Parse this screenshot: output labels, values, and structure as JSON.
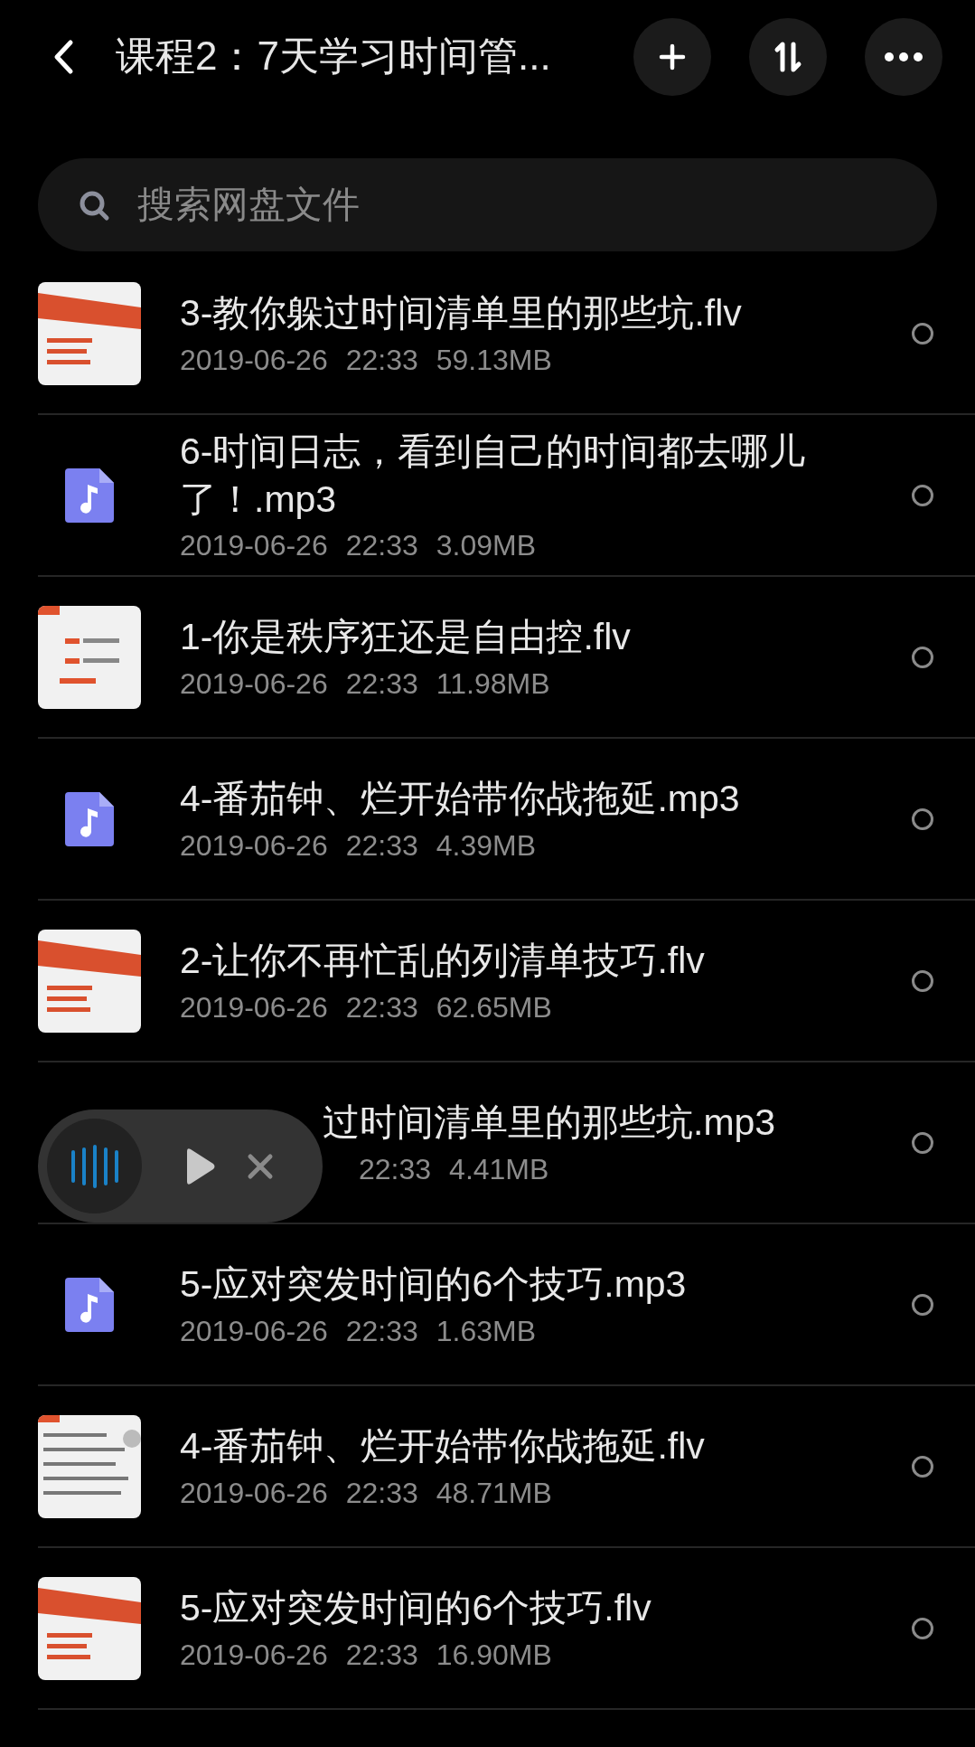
{
  "header": {
    "title": "课程2：7天学习时间管..."
  },
  "search": {
    "placeholder": "搜索网盘文件"
  },
  "files": [
    {
      "kind": "video",
      "title": "3-教你躲过时间清单里的那些坑.flv",
      "date": "2019-06-26",
      "time": "22:33",
      "size": "59.13MB",
      "selected": false
    },
    {
      "kind": "audio",
      "title": "6-时间日志，看到自己的时间都去哪儿了！.mp3",
      "date": "2019-06-26",
      "time": "22:33",
      "size": "3.09MB",
      "selected": false
    },
    {
      "kind": "video",
      "title": "1-你是秩序狂还是自由控.flv",
      "date": "2019-06-26",
      "time": "22:33",
      "size": "11.98MB",
      "selected": false
    },
    {
      "kind": "audio",
      "title": "4-番茄钟、烂开始带你战拖延.mp3",
      "date": "2019-06-26",
      "time": "22:33",
      "size": "4.39MB",
      "selected": false
    },
    {
      "kind": "video",
      "title": "2-让你不再忙乱的列清单技巧.flv",
      "date": "2019-06-26",
      "time": "22:33",
      "size": "62.65MB",
      "selected": false
    },
    {
      "kind": "covered",
      "title": "过时间清单里的那些坑.mp3",
      "time": "22:33",
      "size": "4.41MB",
      "selected": false
    },
    {
      "kind": "audio",
      "title": "5-应对突发时间的6个技巧.mp3",
      "date": "2019-06-26",
      "time": "22:33",
      "size": "1.63MB",
      "selected": false
    },
    {
      "kind": "video",
      "title": "4-番茄钟、烂开始带你战拖延.flv",
      "date": "2019-06-26",
      "time": "22:33",
      "size": "48.71MB",
      "selected": false
    },
    {
      "kind": "video",
      "title": "5-应对突发时间的6个技巧.flv",
      "date": "2019-06-26",
      "time": "22:33",
      "size": "16.90MB",
      "selected": false
    }
  ],
  "player": {
    "playing": false
  }
}
